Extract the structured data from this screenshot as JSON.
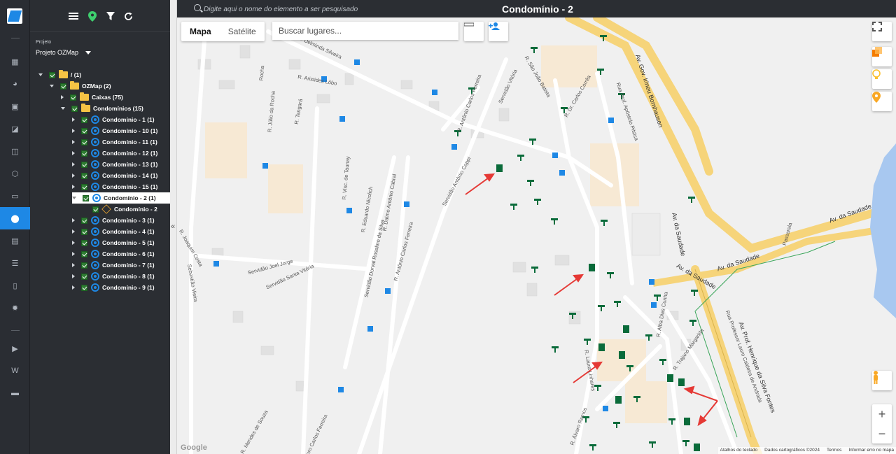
{
  "app": {
    "search_placeholder": "Digite aqui o nome do elemento a ser pesquisado",
    "title": "Condomínio - 2"
  },
  "sidebar": {
    "project_label": "Projeto",
    "project_value": "Projeto OZMap",
    "tree": [
      {
        "label": "/ (1)",
        "type": "folder"
      },
      {
        "label": "OZMap (2)",
        "type": "folder"
      },
      {
        "label": "Caixas (75)",
        "type": "folder"
      },
      {
        "label": "Condomínios (15)",
        "type": "folder"
      },
      {
        "label": "Condomínio - 1 (1)",
        "type": "condo"
      },
      {
        "label": "Condomínio - 10 (1)",
        "type": "condo"
      },
      {
        "label": "Condomínio - 11 (1)",
        "type": "condo"
      },
      {
        "label": "Condomínio - 12 (1)",
        "type": "condo"
      },
      {
        "label": "Condomínio - 13 (1)",
        "type": "condo"
      },
      {
        "label": "Condomínio - 14 (1)",
        "type": "condo"
      },
      {
        "label": "Condomínio - 15 (1)",
        "type": "condo"
      },
      {
        "label": "Condomínio - 2 (1)",
        "type": "condo"
      },
      {
        "label": "Condomínio - 2",
        "type": "building"
      },
      {
        "label": "Condomínio - 3 (1)",
        "type": "condo"
      },
      {
        "label": "Condomínio - 4 (1)",
        "type": "condo"
      },
      {
        "label": "Condomínio - 5 (1)",
        "type": "condo"
      },
      {
        "label": "Condomínio - 6 (1)",
        "type": "condo"
      },
      {
        "label": "Condomínio - 7 (1)",
        "type": "condo"
      },
      {
        "label": "Condomínio - 8 (1)",
        "type": "condo"
      },
      {
        "label": "Condomínio - 9 (1)",
        "type": "condo"
      }
    ]
  },
  "map": {
    "type_map": "Mapa",
    "type_satellite": "Satélite",
    "places_placeholder": "Buscar lugares...",
    "zoom_in": "+",
    "zoom_out": "−",
    "google": "Google",
    "attribution": [
      "Atalhos do teclado",
      "Dados cartográficos ©2024",
      "Termos",
      "Informar erro no mapa"
    ],
    "streets": [
      "R. Delminda Silveira",
      "R. Aristides Lôbo",
      "R. São João Batista",
      "R. Antônio Carlos Ferreira",
      "Servidão Vitória",
      "R. Dr. Carlos Corrêa",
      "Av. Gov. Irineu Bornhausen",
      "Rua Prof. Apóstolo Pitsica",
      "R. Tangará",
      "R. Júlio da Rocha",
      "Rocha",
      "R. Visc. de Taunay",
      "R. Eduardo Nicolich",
      "R. Dalmo Antônio Cabral",
      "Servidão Antônio Coppi",
      "Servidão Joel Jorge",
      "Servidão Santa Vitória",
      "Servidão Dorval Rosalino da Silva",
      "R. Antônio Carlos Ferreira",
      "R. Joaquim Costa",
      "Sebastião Vieira",
      "Av. da Saudade",
      "Av. Prof. Henrique da Silva Fontes",
      "R. Laura Linhares",
      "R. Alba Dias Cunha",
      "R. Trajano Margarida",
      "Rua Professor Lauro Caldeira de Andrada",
      "R. Álvaro Ramos",
      "R. Mendes de Souza",
      "R. Lauro Carlos Ferreira",
      "Passarela"
    ]
  },
  "colors": {
    "accent": "#1e88e5",
    "checkbox": "#2e7d32",
    "folder": "#f6c344",
    "marker": "#0a6b3a",
    "highway": "#f6d47a",
    "arrow": "#e53935"
  }
}
